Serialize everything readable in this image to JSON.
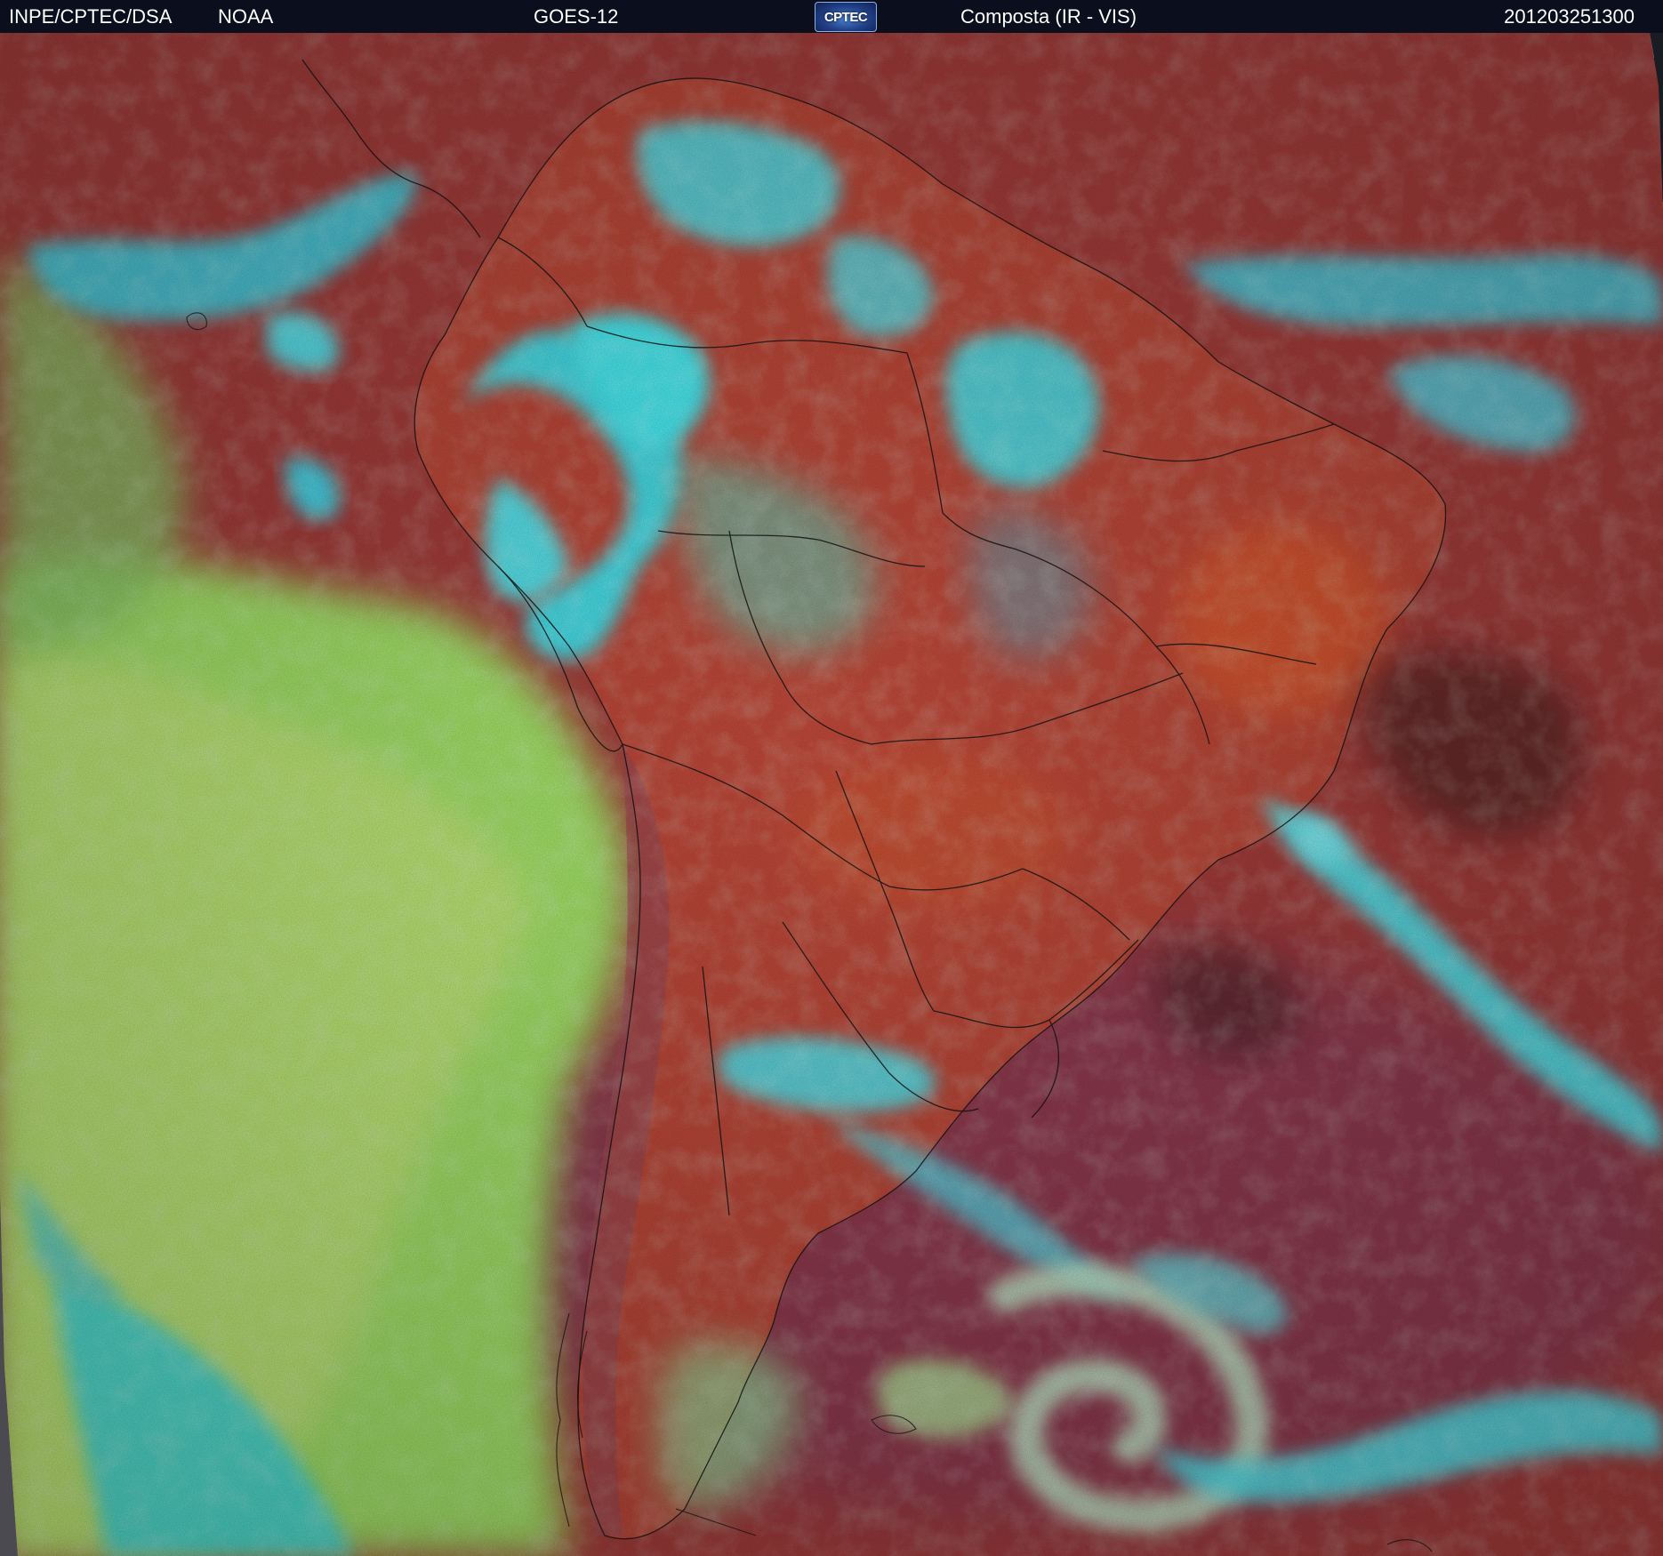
{
  "header": {
    "organization": "INPE/CPTEC/DSA",
    "agency": "NOAA",
    "satellite": "GOES-12",
    "logo_text": "CPTEC",
    "product": "Composta (IR - VIS)",
    "timestamp": "201203251300"
  },
  "colors": {
    "header_bg": "#0b0f1d",
    "header_text": "#ffffff",
    "space": "#9a9aa0",
    "land_clear": "#c0493a",
    "ocean_clear": "#a83e3c",
    "cold_high_cloud": "#33e6f2",
    "low_cloud": "#aaee66",
    "mid_cloud": "#6fbfa8",
    "coastline": "#111111"
  },
  "icons": {
    "logo": "cptec-logo-icon"
  }
}
